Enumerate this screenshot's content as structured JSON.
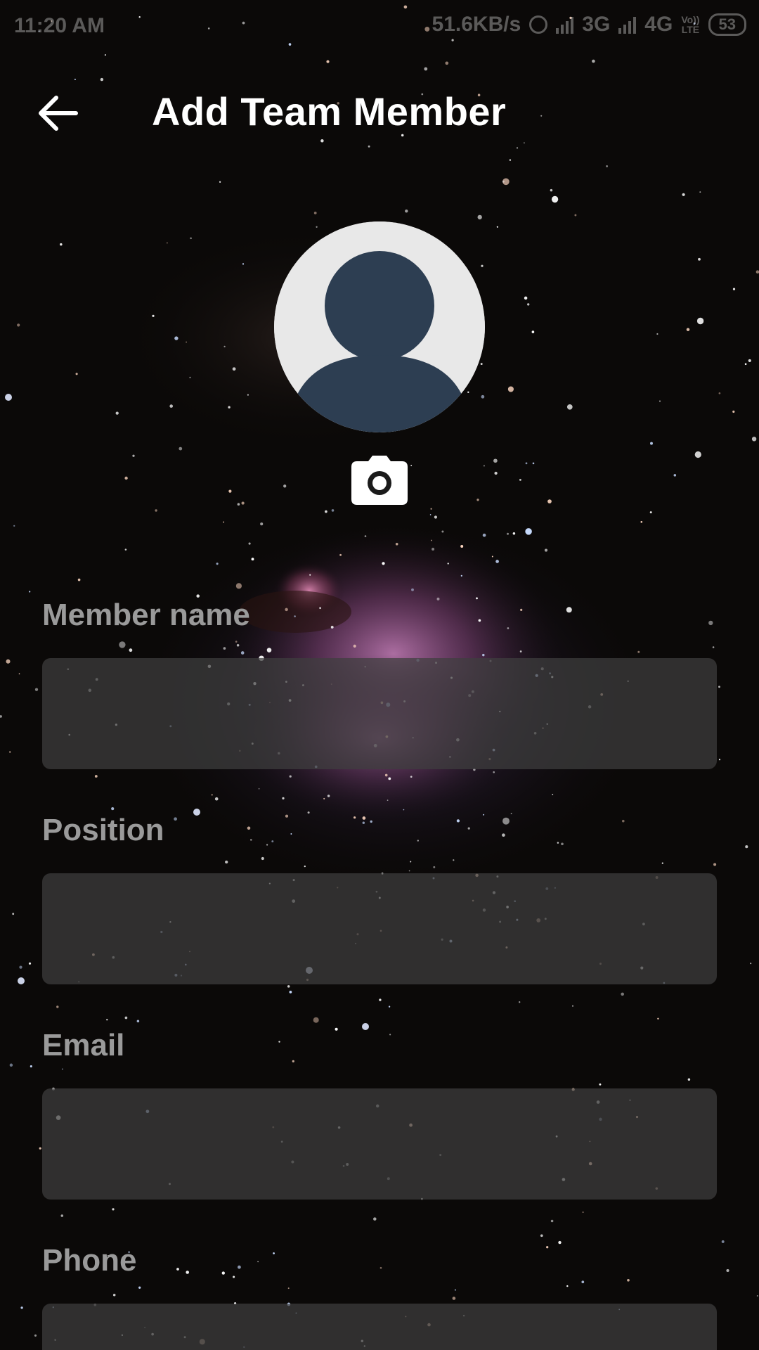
{
  "status_bar": {
    "time": "11:20 AM",
    "network_speed": "51.6KB/s",
    "alarm_icon": "alarm-icon",
    "network_1": "3G",
    "network_2": "4G",
    "volte_top": "Vo))",
    "volte_bottom": "LTE",
    "battery": "53"
  },
  "header": {
    "back_icon": "arrow-left-icon",
    "title": "Add Team Member"
  },
  "avatar": {
    "icon": "default-user-avatar-icon",
    "camera_icon": "camera-icon"
  },
  "form": {
    "fields": [
      {
        "label": "Member name",
        "value": "",
        "placeholder": ""
      },
      {
        "label": "Position",
        "value": "",
        "placeholder": ""
      },
      {
        "label": "Email",
        "value": "",
        "placeholder": ""
      },
      {
        "label": "Phone",
        "value": "",
        "placeholder": ""
      }
    ]
  },
  "colors": {
    "background": "#0b0908",
    "avatar_bg": "#e8e8e8",
    "avatar_figure": "#2d3e52",
    "label": "#9a9a9a",
    "input_bg": "#3e3e3e",
    "title": "#ffffff"
  }
}
